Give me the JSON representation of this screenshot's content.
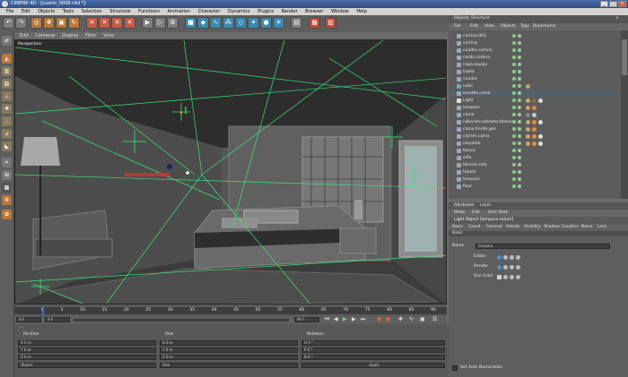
{
  "titlebar": {
    "title": "CINEMA 4D - [cuarto_0008.c4d *]",
    "min": "_",
    "max": "□",
    "close": "×"
  },
  "menubar": {
    "items": [
      "File",
      "Edit",
      "Objects",
      "Tools",
      "Selection",
      "Structure",
      "Functions",
      "Animation",
      "Character",
      "Dynamics",
      "Plugins",
      "Render",
      "Browser",
      "Window",
      "Help"
    ]
  },
  "viewport": {
    "menu": [
      "Edit",
      "Cameras",
      "Display",
      "Filter",
      "View"
    ],
    "label": "Perspective"
  },
  "timeline": {
    "ticks": [
      "0",
      "5",
      "10",
      "15",
      "20",
      "25",
      "30",
      "35",
      "40",
      "45",
      "50",
      "55",
      "60",
      "65",
      "70",
      "75",
      "80",
      "85",
      "90"
    ],
    "current": "0 F",
    "start": "0 F",
    "end": "90 F"
  },
  "coord": {
    "headers": [
      "Position",
      "Size",
      "Rotation"
    ],
    "rows": [
      {
        "pos": "X  0 m",
        "size": "X  0 m",
        "rot": "H  0 °"
      },
      {
        "pos": "Y  0 m",
        "size": "Y  0 m",
        "rot": "P  0 °"
      },
      {
        "pos": "Z  0 m",
        "size": "Z  0 m",
        "rot": "B  0 °"
      }
    ],
    "mode": "Object",
    "size_mode": "Size",
    "apply": "Apply"
  },
  "objects": {
    "tabs": [
      "Objects",
      "Structure"
    ],
    "menu": [
      "File",
      "Edit",
      "View",
      "Objects",
      "Tags",
      "Bookmarks"
    ],
    "rows": [
      "cortina.001",
      "cortina",
      "cuadro.cortina",
      "nardo.cortina",
      "copa.espejo",
      "toalla",
      "cuadro",
      "cubo",
      "mueble.cama",
      "Light",
      "lampara",
      "cama",
      "cabecero.planeta.titanio",
      "cama.frente.gen",
      "cojines.cama",
      "respaldo",
      "banca",
      "sofa",
      "libreria.sofa",
      "tapete",
      "lampara",
      "floor"
    ]
  },
  "attributes": {
    "tabs": [
      "Attributes",
      "Layer"
    ],
    "menu": [
      "Mode",
      "Edit",
      "User Data"
    ],
    "title": "Light Object [lampara.volum]",
    "subtabs": [
      "Basic",
      "Coord.",
      "General",
      "Details",
      "Visibility",
      "Shadow",
      "Caustics",
      "Noise",
      "Lens"
    ],
    "section": "Basic",
    "fields": [
      {
        "label": "Name",
        "value": "lampara"
      },
      {
        "label": "Editor",
        "value": ""
      },
      {
        "label": "Render",
        "value": ""
      },
      {
        "label": "Use Color",
        "value": ""
      }
    ],
    "bottom": "Set Auto Illumination"
  },
  "colors": {
    "accent": "#2f4f86",
    "guide": "#3fe07a",
    "panel": "#5c5c5c"
  }
}
